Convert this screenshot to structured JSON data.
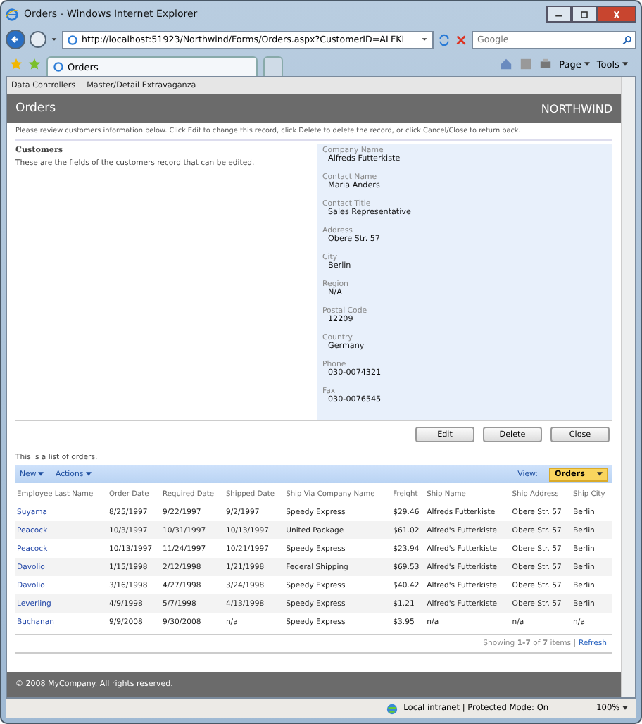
{
  "window": {
    "title": "Orders - Windows Internet Explorer"
  },
  "address_bar": {
    "url": "http://localhost:51923/Northwind/Forms/Orders.aspx?CustomerID=ALFKI"
  },
  "search": {
    "placeholder": "Google"
  },
  "tabs": [
    {
      "label": "Orders",
      "selected": true
    }
  ],
  "command_bar": [
    {
      "label": "Page"
    },
    {
      "label": "Tools"
    }
  ],
  "site_menu": [
    "Data Controllers",
    "Master/Detail Extravaganza"
  ],
  "header": {
    "title": "Orders",
    "brand": "NORTHWIND"
  },
  "instructions": "Please review customers information below. Click Edit to change this record, click Delete to delete the record, or click Cancel/Close to return back.",
  "form": {
    "title": "Customers",
    "description": "These are the fields of the customers record that can be edited.",
    "fields": [
      {
        "label": "Company Name",
        "value": "Alfreds Futterkiste"
      },
      {
        "label": "Contact Name",
        "value": "Maria Anders"
      },
      {
        "label": "Contact Title",
        "value": "Sales Representative"
      },
      {
        "label": "Address",
        "value": "Obere Str. 57"
      },
      {
        "label": "City",
        "value": "Berlin"
      },
      {
        "label": "Region",
        "value": "N/A"
      },
      {
        "label": "Postal Code",
        "value": "12209"
      },
      {
        "label": "Country",
        "value": "Germany"
      },
      {
        "label": "Phone",
        "value": "030-0074321"
      },
      {
        "label": "Fax",
        "value": "030-0076545"
      }
    ],
    "buttons": [
      "Edit",
      "Delete",
      "Close"
    ]
  },
  "orders": {
    "description": "This is a list of orders.",
    "actions": [
      "New",
      "Actions"
    ],
    "view_label": "View:",
    "view": "Orders",
    "columns": [
      "Employee Last Name",
      "Order Date",
      "Required Date",
      "Shipped Date",
      "Ship Via Company Name",
      "Freight",
      "Ship Name",
      "Ship Address",
      "Ship City"
    ],
    "rows": [
      [
        "Suyama",
        "8/25/1997",
        "9/22/1997",
        "9/2/1997",
        "Speedy Express",
        "$29.46",
        "Alfreds Futterkiste",
        "Obere Str. 57",
        "Berlin"
      ],
      [
        "Peacock",
        "10/3/1997",
        "10/31/1997",
        "10/13/1997",
        "United Package",
        "$61.02",
        "Alfred's Futterkiste",
        "Obere Str. 57",
        "Berlin"
      ],
      [
        "Peacock",
        "10/13/1997",
        "11/24/1997",
        "10/21/1997",
        "Speedy Express",
        "$23.94",
        "Alfred's Futterkiste",
        "Obere Str. 57",
        "Berlin"
      ],
      [
        "Davolio",
        "1/15/1998",
        "2/12/1998",
        "1/21/1998",
        "Federal Shipping",
        "$69.53",
        "Alfred's Futterkiste",
        "Obere Str. 57",
        "Berlin"
      ],
      [
        "Davolio",
        "3/16/1998",
        "4/27/1998",
        "3/24/1998",
        "Speedy Express",
        "$40.42",
        "Alfred's Futterkiste",
        "Obere Str. 57",
        "Berlin"
      ],
      [
        "Leverling",
        "4/9/1998",
        "5/7/1998",
        "4/13/1998",
        "Speedy Express",
        "$1.21",
        "Alfred's Futterkiste",
        "Obere Str. 57",
        "Berlin"
      ],
      [
        "Buchanan",
        "9/9/2008",
        "9/30/2008",
        "n/a",
        "Speedy Express",
        "$3.95",
        "n/a",
        "n/a",
        "n/a"
      ]
    ],
    "pager": "Showing **1-7** of **7** items |",
    "refresh": "Refresh"
  },
  "footer": "© 2008 MyCompany. All rights reserved.",
  "status_bar": {
    "zone": "Local intranet | Protected Mode: On",
    "zoom": "100%"
  }
}
